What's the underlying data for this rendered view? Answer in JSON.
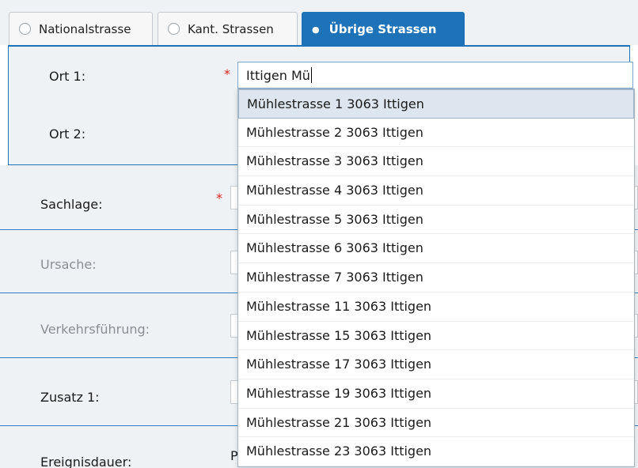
{
  "tabs": [
    {
      "label": "Nationalstrasse",
      "active": false
    },
    {
      "label": "Kant. Strassen",
      "active": false
    },
    {
      "label": "Übrige Strassen",
      "active": true
    }
  ],
  "form": {
    "ort1_label": "Ort 1:",
    "ort1_value": "Ittigen Mü",
    "ort2_label": "Ort 2:",
    "required_mark": "*",
    "sachlage_label": "Sachlage:",
    "ursache_label": "Ursache:",
    "verkehrsfuehrung_label": "Verkehrsführung:",
    "zusatz1_label": "Zusatz 1:",
    "ereignisdauer_label": "Ereignisdauer:",
    "ereignisdauer_partial": "P"
  },
  "autocomplete": {
    "items": [
      "Mühlestrasse 1 3063 Ittigen",
      "Mühlestrasse 2 3063 Ittigen",
      "Mühlestrasse 3 3063 Ittigen",
      "Mühlestrasse 4 3063 Ittigen",
      "Mühlestrasse 5 3063 Ittigen",
      "Mühlestrasse 6 3063 Ittigen",
      "Mühlestrasse 7 3063 Ittigen",
      "Mühlestrasse 11 3063 Ittigen",
      "Mühlestrasse 15 3063 Ittigen",
      "Mühlestrasse 17 3063 Ittigen",
      "Mühlestrasse 19 3063 Ittigen",
      "Mühlestrasse 21 3063 Ittigen",
      "Mühlestrasse 23 3063 Ittigen"
    ]
  },
  "colors": {
    "accent": "#1e72b8",
    "required": "#d9251c",
    "panel_bg": "#eef2f5"
  }
}
